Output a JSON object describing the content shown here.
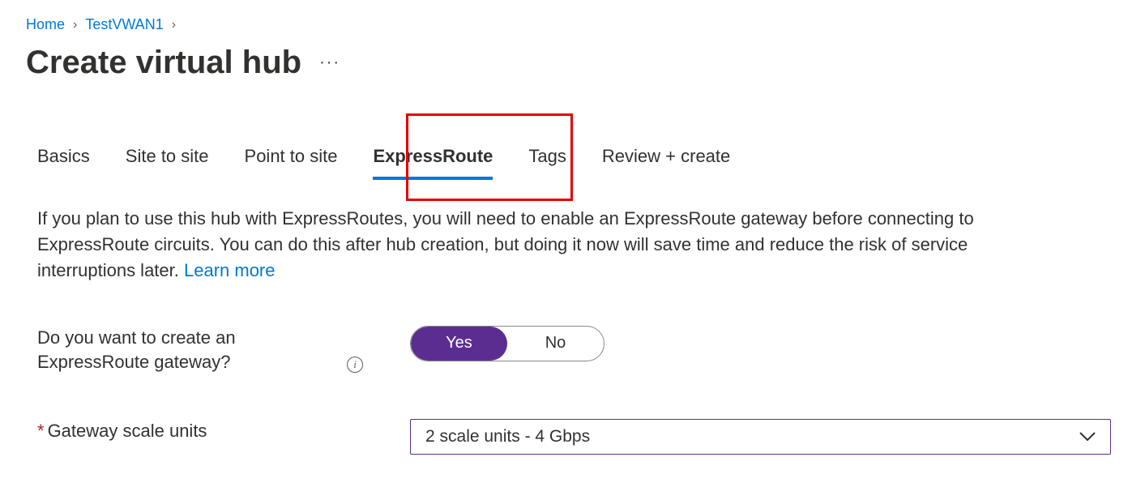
{
  "breadcrumb": {
    "home": "Home",
    "item1": "TestVWAN1"
  },
  "page": {
    "title": "Create virtual hub"
  },
  "tabs": {
    "basics": "Basics",
    "site_to_site": "Site to site",
    "point_to_site": "Point to site",
    "expressroute": "ExpressRoute",
    "tags": "Tags",
    "review_create": "Review + create"
  },
  "description": {
    "text": "If you plan to use this hub with ExpressRoutes, you will need to enable an ExpressRoute gateway before connecting to ExpressRoute circuits. You can do this after hub creation, but doing it now will save time and reduce the risk of service interruptions later.  ",
    "learn_more": "Learn more"
  },
  "form": {
    "create_gateway_label": "Do you want to create an ExpressRoute gateway?",
    "toggle_yes": "Yes",
    "toggle_no": "No",
    "scale_units_label": "Gateway scale units",
    "scale_units_value": "2 scale units - 4 Gbps"
  }
}
